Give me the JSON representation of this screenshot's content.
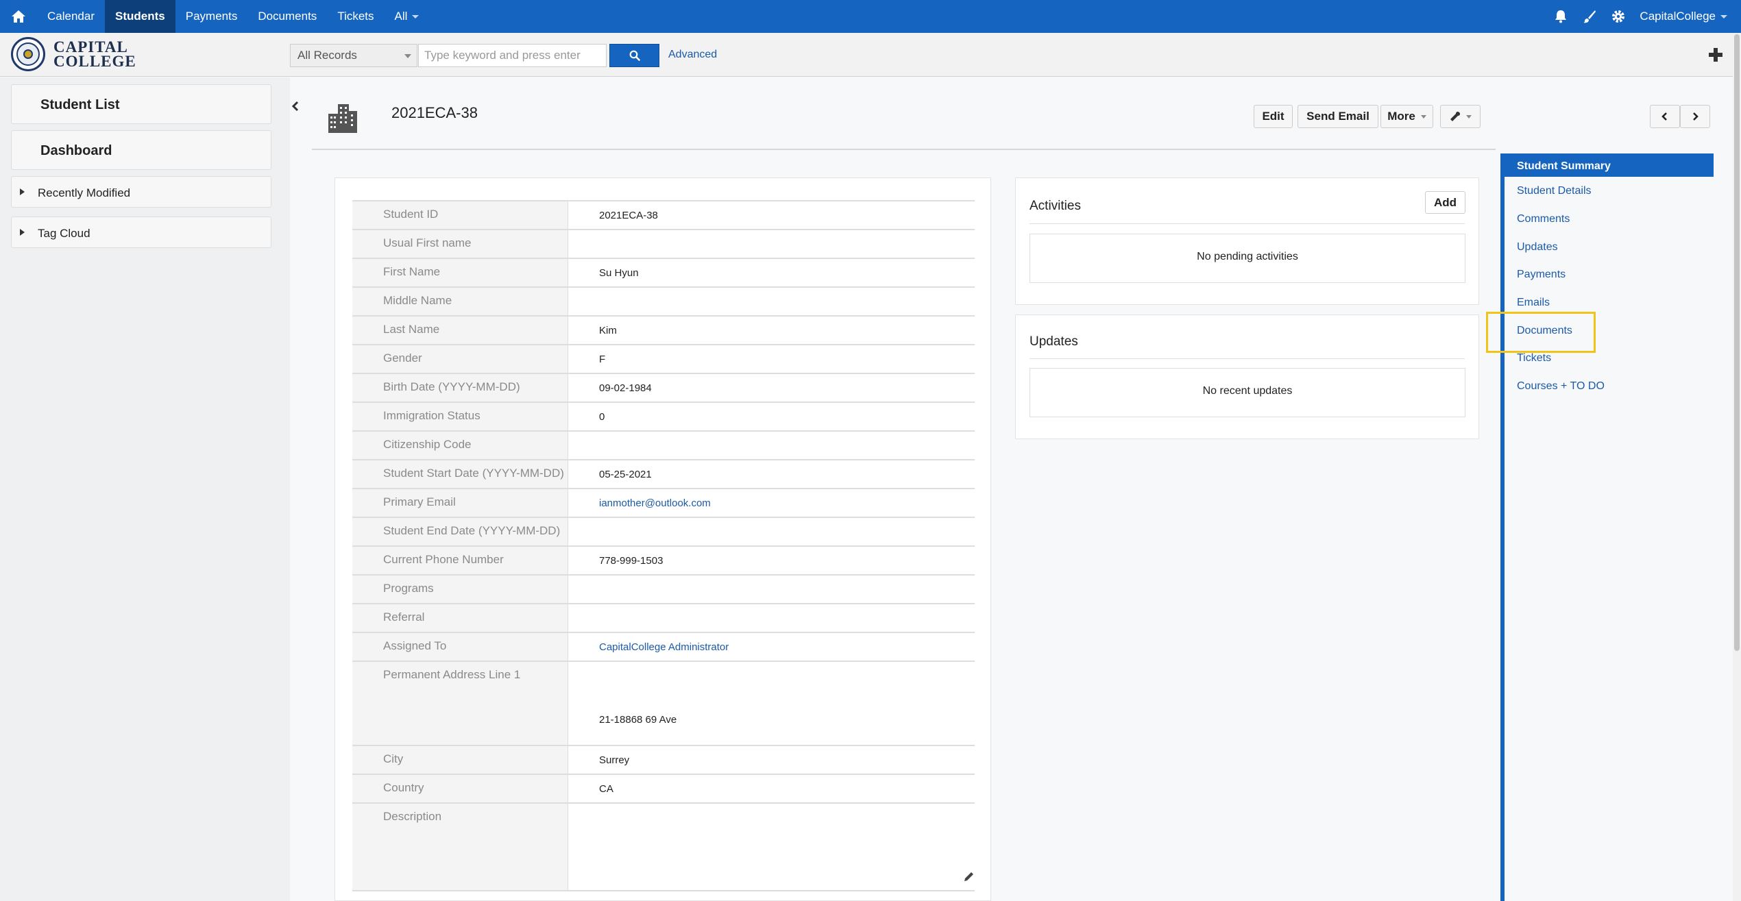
{
  "topnav": {
    "items": [
      "Calendar",
      "Students",
      "Payments",
      "Documents",
      "Tickets",
      "All"
    ],
    "active": "Students",
    "user": "CapitalCollege"
  },
  "logo": {
    "line1": "CAPITAL",
    "line2": "COLLEGE"
  },
  "search": {
    "scope": "All Records",
    "placeholder": "Type keyword and press enter",
    "advanced": "Advanced"
  },
  "sidebar": {
    "student_list": "Student List",
    "dashboard": "Dashboard",
    "recently_modified": "Recently Modified",
    "tag_cloud": "Tag Cloud"
  },
  "record": {
    "title": "2021ECA-38",
    "buttons": {
      "edit": "Edit",
      "send_email": "Send Email",
      "more": "More"
    }
  },
  "details": [
    {
      "label": "Student ID",
      "value": "2021ECA-38"
    },
    {
      "label": "Usual First name",
      "value": ""
    },
    {
      "label": "First Name",
      "value": "Su Hyun"
    },
    {
      "label": "Middle Name",
      "value": ""
    },
    {
      "label": "Last Name",
      "value": "Kim"
    },
    {
      "label": "Gender",
      "value": "F"
    },
    {
      "label": "Birth Date (YYYY-MM-DD)",
      "value": "09-02-1984"
    },
    {
      "label": "Immigration Status",
      "value": "0"
    },
    {
      "label": "Citizenship Code",
      "value": ""
    },
    {
      "label": "Student Start Date (YYYY-MM-DD)",
      "value": "05-25-2021"
    },
    {
      "label": "Primary Email",
      "value": "ianmother@outlook.com"
    },
    {
      "label": "Student End Date (YYYY-MM-DD)",
      "value": ""
    },
    {
      "label": "Current Phone Number",
      "value": "778-999-1503"
    },
    {
      "label": "Programs",
      "value": ""
    },
    {
      "label": "Referral",
      "value": ""
    },
    {
      "label": "Assigned To",
      "value": "CapitalCollege Administrator"
    },
    {
      "label": "Permanent Address Line 1",
      "value": "21-18868 69 Ave"
    },
    {
      "label": "City",
      "value": "Surrey"
    },
    {
      "label": "Country",
      "value": "CA"
    },
    {
      "label": "Description",
      "value": ""
    }
  ],
  "activities": {
    "title": "Activities",
    "add": "Add",
    "empty": "No pending activities"
  },
  "updates": {
    "title": "Updates",
    "empty": "No recent updates"
  },
  "right_nav": {
    "items": [
      "Student Summary",
      "Student Details",
      "Comments",
      "Updates",
      "Payments",
      "Emails",
      "Documents",
      "Tickets",
      "Courses + TO DO"
    ],
    "active": "Student Summary",
    "highlighted": "Documents"
  },
  "colors": {
    "brand_blue": "#1565c0",
    "nav_active": "#0d3f7a",
    "link": "#1a5aa8",
    "highlight": "#f0c419"
  }
}
